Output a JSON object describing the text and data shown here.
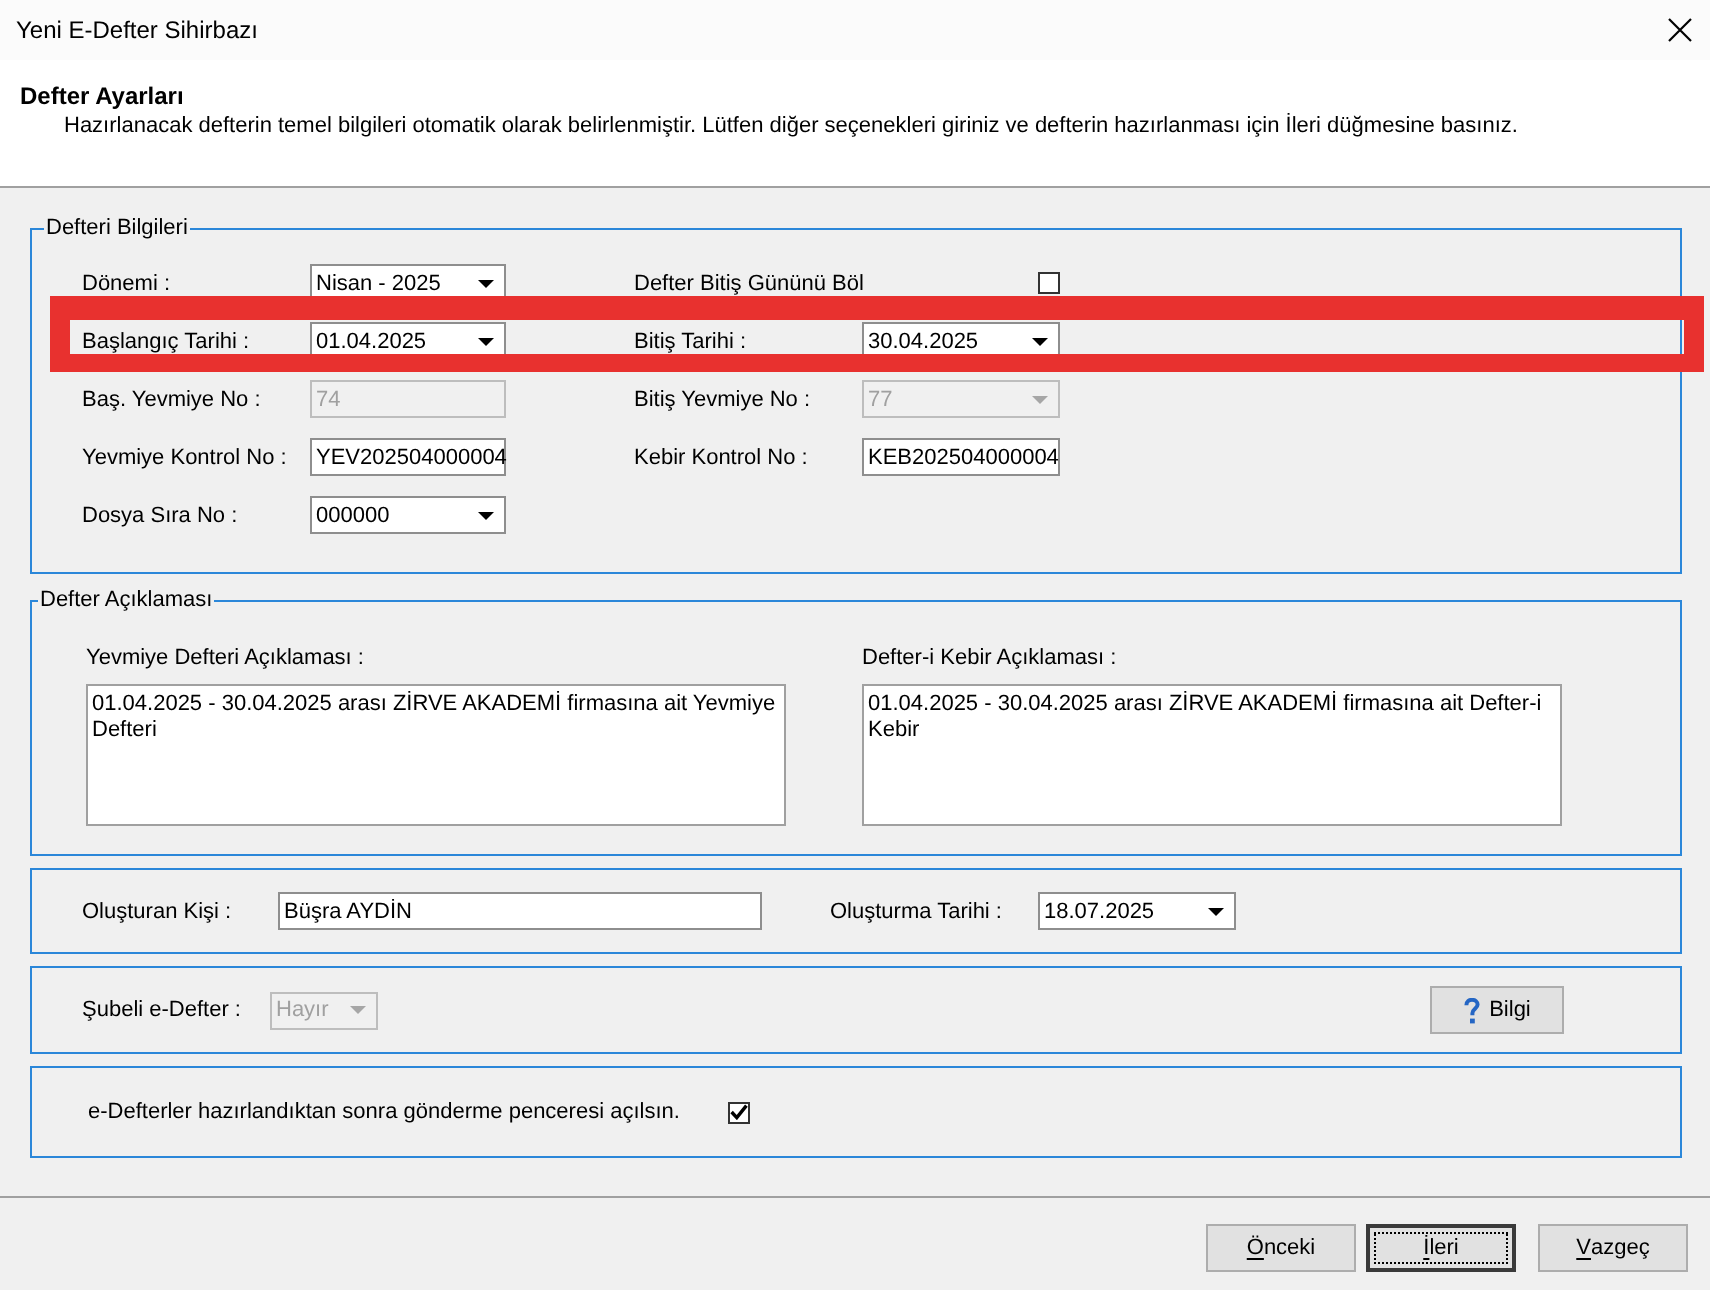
{
  "window": {
    "title": "Yeni E-Defter Sihirbazı"
  },
  "header": {
    "title": "Defter Ayarları",
    "description": "Hazırlanacak defterin temel bilgileri otomatik olarak belirlenmiştir. Lütfen diğer seçenekleri giriniz ve defterin hazırlanması için İleri düğmesine basınız."
  },
  "book_info": {
    "legend": "Defteri Bilgileri",
    "rows": [
      {
        "highlighted": false,
        "fields": [
          {
            "kind": "combobox",
            "label": "Dönemi :",
            "value": "Nisan - 2025",
            "disabled": false
          },
          {
            "kind": "checkbox",
            "label": "Defter Bitiş Gününü Böl",
            "checked": false
          }
        ]
      },
      {
        "highlighted": true,
        "fields": [
          {
            "kind": "combobox",
            "label": "Başlangıç Tarihi :",
            "value": "01.04.2025",
            "disabled": false
          },
          {
            "kind": "combobox",
            "label": "Bitiş Tarihi :",
            "value": "30.04.2025",
            "disabled": false
          }
        ]
      },
      {
        "highlighted": false,
        "fields": [
          {
            "kind": "textbox",
            "label": "Baş. Yevmiye No :",
            "value": "74",
            "disabled": true
          },
          {
            "kind": "combobox",
            "label": "Bitiş Yevmiye No :",
            "value": "77",
            "disabled": true
          }
        ]
      },
      {
        "highlighted": false,
        "fields": [
          {
            "kind": "textbox",
            "label": "Yevmiye Kontrol No :",
            "value": "YEV202504000004",
            "disabled": false
          },
          {
            "kind": "textbox",
            "label": "Kebir Kontrol No :",
            "value": "KEB202504000004",
            "disabled": false
          }
        ]
      },
      {
        "highlighted": false,
        "fields": [
          {
            "kind": "combobox",
            "label": "Dosya Sıra No :",
            "value": "000000",
            "disabled": false
          }
        ]
      }
    ]
  },
  "book_description": {
    "legend": "Defter Açıklaması",
    "fields": [
      {
        "label": "Yevmiye Defteri Açıklaması :",
        "value": "01.04.2025 - 30.04.2025 arası ZİRVE AKADEMİ firmasına ait Yevmiye Defteri"
      },
      {
        "label": "Defter-i Kebir Açıklaması :",
        "value": "01.04.2025 - 30.04.2025 arası ZİRVE AKADEMİ firmasına ait Defter-i Kebir"
      }
    ]
  },
  "creator": {
    "fields": [
      {
        "kind": "textbox",
        "label": "Oluşturan Kişi :",
        "value": "Büşra AYDİN",
        "disabled": false
      },
      {
        "kind": "combobox",
        "label": "Oluşturma Tarihi :",
        "value": "18.07.2025",
        "disabled": false
      }
    ]
  },
  "branch": {
    "field": {
      "kind": "combobox",
      "label": "Şubeli e-Defter :",
      "value": "Hayır",
      "disabled": true
    },
    "info_button": {
      "label": "Bilgi"
    }
  },
  "send_option": {
    "label": "e-Defterler hazırlandıktan sonra gönderme penceresi açılsın.",
    "checked": true
  },
  "buttons": [
    {
      "label": "Önceki",
      "focused": false,
      "mnemonic_underlined": true
    },
    {
      "label": "İleri",
      "focused": true,
      "mnemonic_underlined": true
    },
    {
      "label": "Vazgeç",
      "focused": false,
      "mnemonic_underlined": true
    }
  ]
}
